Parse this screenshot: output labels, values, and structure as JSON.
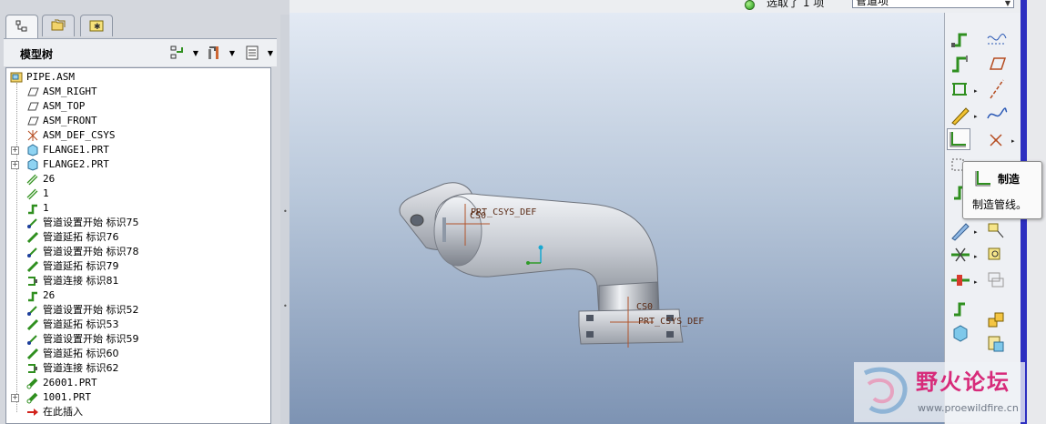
{
  "status_bar": {
    "selection_text": "选取了 1 项",
    "filter_value": "管道项"
  },
  "left_panel": {
    "header_title": "模型树",
    "tree": [
      {
        "label": "PIPE.ASM",
        "icon": "assembly-icon",
        "indent": 0,
        "expandable": false,
        "cjk": false
      },
      {
        "label": "ASM_RIGHT",
        "icon": "datum-plane-icon",
        "indent": 1,
        "expandable": false,
        "cjk": false
      },
      {
        "label": "ASM_TOP",
        "icon": "datum-plane-icon",
        "indent": 1,
        "expandable": false,
        "cjk": false
      },
      {
        "label": "ASM_FRONT",
        "icon": "datum-plane-icon",
        "indent": 1,
        "expandable": false,
        "cjk": false
      },
      {
        "label": "ASM_DEF_CSYS",
        "icon": "csys-icon",
        "indent": 1,
        "expandable": false,
        "cjk": false
      },
      {
        "label": "FLANGE1.PRT",
        "icon": "part-icon",
        "indent": 1,
        "expandable": true,
        "cjk": false
      },
      {
        "label": "FLANGE2.PRT",
        "icon": "part-icon",
        "indent": 1,
        "expandable": true,
        "cjk": false
      },
      {
        "label": "26",
        "icon": "pipe-spec-icon",
        "indent": 1,
        "expandable": false,
        "cjk": false
      },
      {
        "label": "1",
        "icon": "pipe-spec-icon",
        "indent": 1,
        "expandable": false,
        "cjk": false
      },
      {
        "label": "1",
        "icon": "pipe-route-icon",
        "indent": 1,
        "expandable": false,
        "cjk": false
      },
      {
        "label": "管道设置开始 标识75",
        "icon": "pipe-start-icon",
        "indent": 1,
        "expandable": false,
        "cjk": true
      },
      {
        "label": "管道延拓 标识76",
        "icon": "pipe-extend-icon",
        "indent": 1,
        "expandable": false,
        "cjk": true
      },
      {
        "label": "管道设置开始 标识78",
        "icon": "pipe-start-icon",
        "indent": 1,
        "expandable": false,
        "cjk": true
      },
      {
        "label": "管道延拓 标识79",
        "icon": "pipe-extend-icon",
        "indent": 1,
        "expandable": false,
        "cjk": true
      },
      {
        "label": "管道连接 标识81",
        "icon": "pipe-connect-icon",
        "indent": 1,
        "expandable": false,
        "cjk": true
      },
      {
        "label": "26",
        "icon": "pipe-route-icon",
        "indent": 1,
        "expandable": false,
        "cjk": false
      },
      {
        "label": "管道设置开始 标识52",
        "icon": "pipe-start-icon",
        "indent": 1,
        "expandable": false,
        "cjk": true
      },
      {
        "label": "管道延拓 标识53",
        "icon": "pipe-extend-icon",
        "indent": 1,
        "expandable": false,
        "cjk": true
      },
      {
        "label": "管道设置开始 标识59",
        "icon": "pipe-start-icon",
        "indent": 1,
        "expandable": false,
        "cjk": true
      },
      {
        "label": "管道延拓 标识60",
        "icon": "pipe-extend-icon",
        "indent": 1,
        "expandable": false,
        "cjk": true
      },
      {
        "label": "管道连接 标识62",
        "icon": "pipe-connect-icon",
        "indent": 1,
        "expandable": false,
        "cjk": true
      },
      {
        "label": "26001.PRT",
        "icon": "pipe-part-icon",
        "indent": 1,
        "expandable": false,
        "cjk": false
      },
      {
        "label": "1001.PRT",
        "icon": "pipe-part-icon",
        "indent": 1,
        "expandable": true,
        "cjk": false
      },
      {
        "label": "在此插入",
        "icon": "insert-here-icon",
        "indent": 1,
        "expandable": false,
        "cjk": true
      }
    ]
  },
  "viewport": {
    "labels": {
      "csys_top_prefix": "CS0",
      "csys_top": "PRT_CSYS_DEF",
      "csys_bottom_prefix": "CS0",
      "csys_bottom": "PRT_CSYS_DEF"
    }
  },
  "tooltip": {
    "title": "制造",
    "description": "制造管线。"
  },
  "watermark": {
    "text_cn": "野火论坛",
    "url": "www.proewildfire.cn"
  },
  "colors": {
    "accent_edge": "#2d2fc0",
    "watermark_pink": "#d72b7a",
    "pipe_green": "#2f8f1f"
  }
}
